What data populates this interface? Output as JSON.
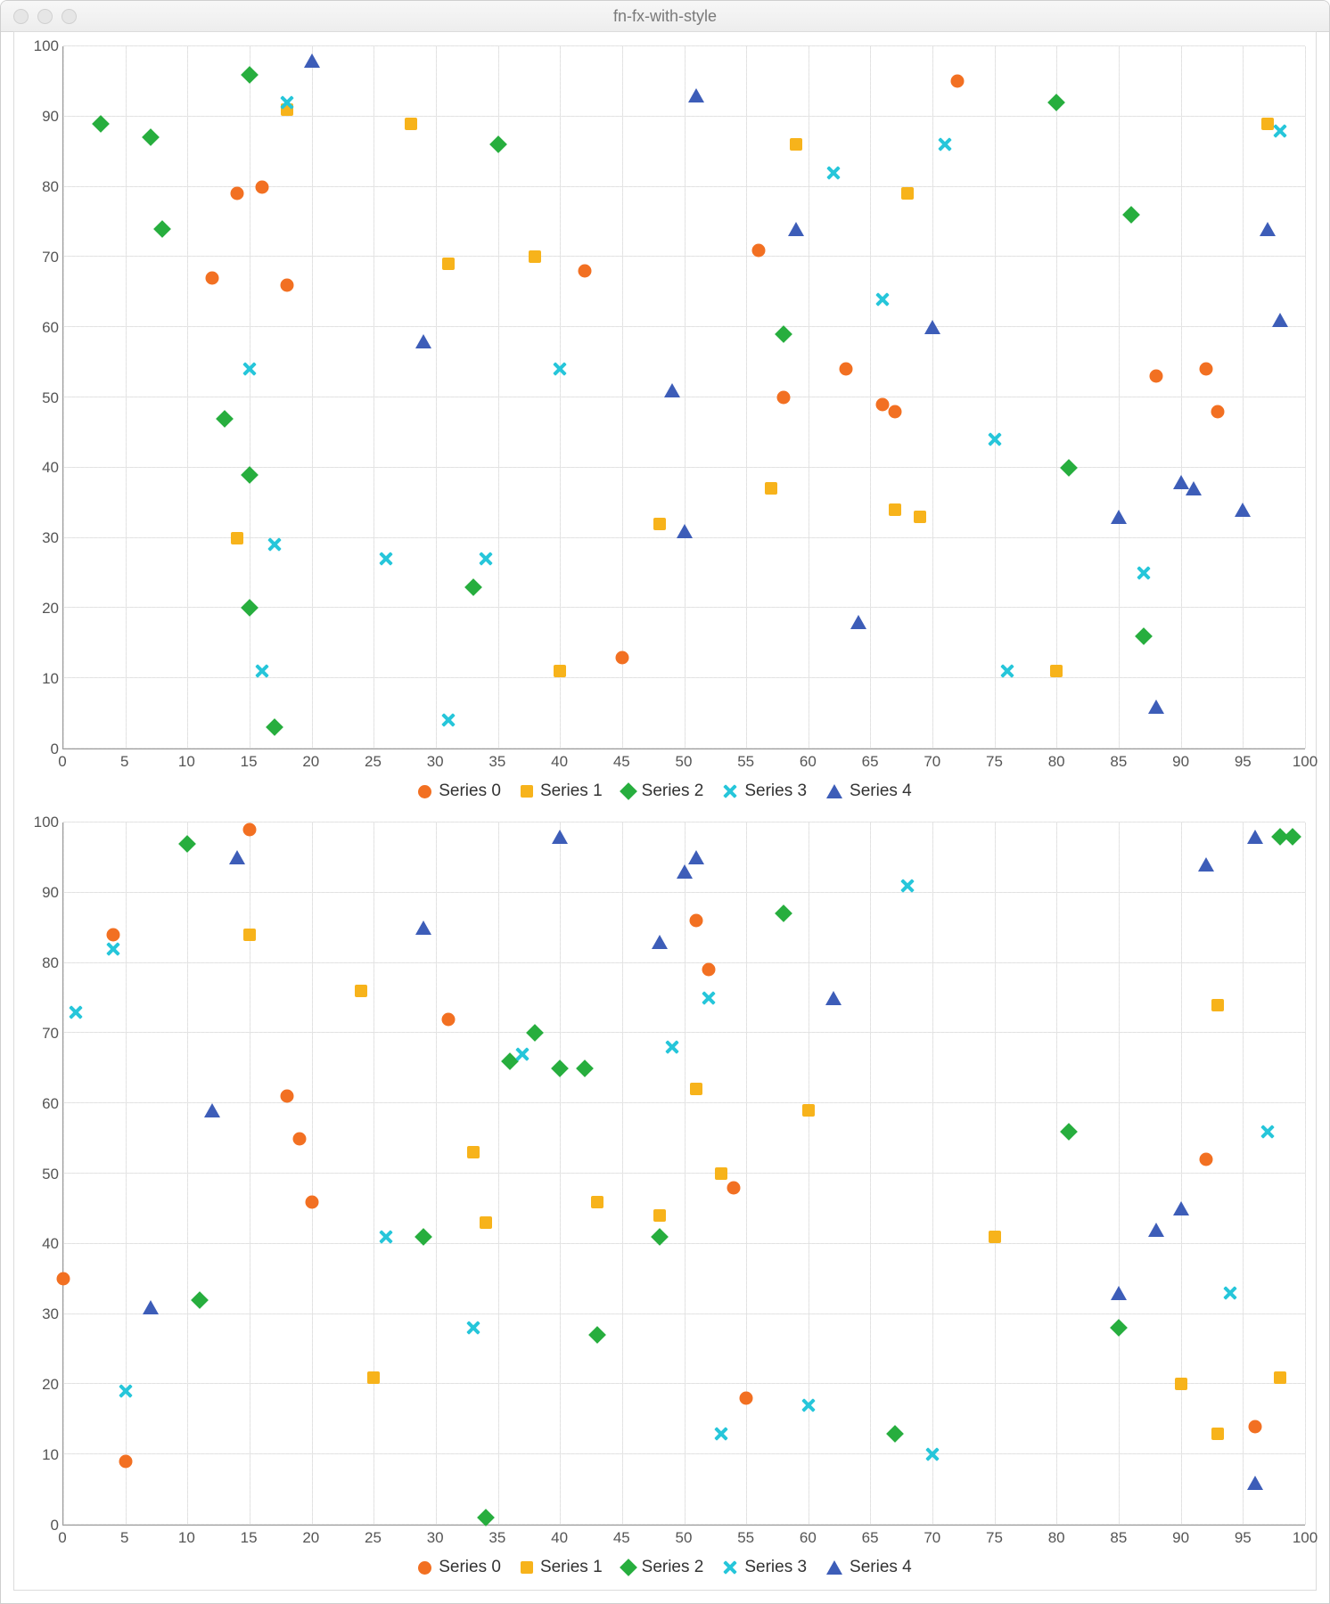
{
  "window": {
    "title": "fn-fx-with-style"
  },
  "colors": {
    "series0": "#f27022",
    "series1": "#f7b31b",
    "series2": "#27ae3e",
    "series3": "#26c6da",
    "series4": "#3d5db8"
  },
  "legend_labels": [
    "Series 0",
    "Series 1",
    "Series 2",
    "Series 3",
    "Series 4"
  ],
  "axis": {
    "xmin": 0,
    "xmax": 100,
    "ymin": 0,
    "ymax": 100,
    "xticks": [
      0,
      5,
      10,
      15,
      20,
      25,
      30,
      35,
      40,
      45,
      50,
      55,
      60,
      65,
      70,
      75,
      80,
      85,
      90,
      95,
      100
    ],
    "yticks": [
      0,
      10,
      20,
      30,
      40,
      50,
      60,
      70,
      80,
      90,
      100
    ]
  },
  "chart_data": [
    {
      "type": "scatter",
      "xlim": [
        0,
        100
      ],
      "ylim": [
        0,
        100
      ],
      "legend": [
        "Series 0",
        "Series 1",
        "Series 2",
        "Series 3",
        "Series 4"
      ],
      "series": [
        {
          "name": "Series 0",
          "marker": "circle",
          "color": "#f27022",
          "points": [
            [
              12,
              67
            ],
            [
              14,
              79
            ],
            [
              16,
              80
            ],
            [
              18,
              66
            ],
            [
              42,
              68
            ],
            [
              45,
              13
            ],
            [
              56,
              71
            ],
            [
              58,
              50
            ],
            [
              63,
              54
            ],
            [
              66,
              49
            ],
            [
              67,
              48
            ],
            [
              72,
              95
            ],
            [
              88,
              53
            ],
            [
              92,
              54
            ],
            [
              93,
              48
            ]
          ]
        },
        {
          "name": "Series 1",
          "marker": "square",
          "color": "#f7b31b",
          "points": [
            [
              14,
              30
            ],
            [
              18,
              91
            ],
            [
              28,
              89
            ],
            [
              31,
              69
            ],
            [
              38,
              70
            ],
            [
              40,
              11
            ],
            [
              48,
              32
            ],
            [
              57,
              37
            ],
            [
              59,
              86
            ],
            [
              67,
              34
            ],
            [
              68,
              79
            ],
            [
              69,
              33
            ],
            [
              80,
              11
            ],
            [
              97,
              89
            ]
          ]
        },
        {
          "name": "Series 2",
          "marker": "diamond",
          "color": "#27ae3e",
          "points": [
            [
              3,
              89
            ],
            [
              7,
              87
            ],
            [
              8,
              74
            ],
            [
              13,
              47
            ],
            [
              15,
              20
            ],
            [
              15,
              39
            ],
            [
              15,
              96
            ],
            [
              17,
              3
            ],
            [
              33,
              23
            ],
            [
              35,
              86
            ],
            [
              58,
              59
            ],
            [
              80,
              92
            ],
            [
              81,
              40
            ],
            [
              86,
              76
            ],
            [
              87,
              16
            ]
          ]
        },
        {
          "name": "Series 3",
          "marker": "cross",
          "color": "#26c6da",
          "points": [
            [
              15,
              54
            ],
            [
              16,
              11
            ],
            [
              17,
              29
            ],
            [
              18,
              92
            ],
            [
              26,
              27
            ],
            [
              31,
              4
            ],
            [
              34,
              27
            ],
            [
              40,
              54
            ],
            [
              62,
              82
            ],
            [
              66,
              64
            ],
            [
              71,
              86
            ],
            [
              75,
              44
            ],
            [
              76,
              11
            ],
            [
              87,
              25
            ],
            [
              98,
              88
            ]
          ]
        },
        {
          "name": "Series 4",
          "marker": "triangle",
          "color": "#3d5db8",
          "points": [
            [
              20,
              98
            ],
            [
              29,
              58
            ],
            [
              49,
              51
            ],
            [
              50,
              31
            ],
            [
              51,
              93
            ],
            [
              59,
              74
            ],
            [
              64,
              18
            ],
            [
              70,
              60
            ],
            [
              85,
              33
            ],
            [
              88,
              6
            ],
            [
              90,
              38
            ],
            [
              91,
              37
            ],
            [
              95,
              34
            ],
            [
              97,
              74
            ],
            [
              98,
              61
            ]
          ]
        }
      ]
    },
    {
      "type": "scatter",
      "xlim": [
        0,
        100
      ],
      "ylim": [
        0,
        100
      ],
      "legend": [
        "Series 0",
        "Series 1",
        "Series 2",
        "Series 3",
        "Series 4"
      ],
      "series": [
        {
          "name": "Series 0",
          "marker": "circle",
          "color": "#f27022",
          "points": [
            [
              0,
              35
            ],
            [
              4,
              84
            ],
            [
              5,
              9
            ],
            [
              15,
              99
            ],
            [
              18,
              61
            ],
            [
              19,
              55
            ],
            [
              20,
              46
            ],
            [
              31,
              72
            ],
            [
              51,
              86
            ],
            [
              52,
              79
            ],
            [
              54,
              48
            ],
            [
              55,
              18
            ],
            [
              92,
              52
            ],
            [
              96,
              14
            ]
          ]
        },
        {
          "name": "Series 1",
          "marker": "square",
          "color": "#f7b31b",
          "points": [
            [
              15,
              84
            ],
            [
              24,
              76
            ],
            [
              25,
              21
            ],
            [
              33,
              53
            ],
            [
              34,
              43
            ],
            [
              43,
              46
            ],
            [
              48,
              44
            ],
            [
              51,
              62
            ],
            [
              53,
              50
            ],
            [
              60,
              59
            ],
            [
              75,
              41
            ],
            [
              90,
              20
            ],
            [
              93,
              13
            ],
            [
              93,
              74
            ],
            [
              98,
              21
            ]
          ]
        },
        {
          "name": "Series 2",
          "marker": "diamond",
          "color": "#27ae3e",
          "points": [
            [
              10,
              97
            ],
            [
              11,
              32
            ],
            [
              29,
              41
            ],
            [
              34,
              1
            ],
            [
              36,
              66
            ],
            [
              38,
              70
            ],
            [
              40,
              65
            ],
            [
              42,
              65
            ],
            [
              43,
              27
            ],
            [
              48,
              41
            ],
            [
              58,
              87
            ],
            [
              67,
              13
            ],
            [
              81,
              56
            ],
            [
              85,
              28
            ],
            [
              98,
              98
            ],
            [
              99,
              98
            ]
          ]
        },
        {
          "name": "Series 3",
          "marker": "cross",
          "color": "#26c6da",
          "points": [
            [
              1,
              73
            ],
            [
              4,
              82
            ],
            [
              5,
              19
            ],
            [
              26,
              41
            ],
            [
              33,
              28
            ],
            [
              37,
              67
            ],
            [
              49,
              68
            ],
            [
              52,
              75
            ],
            [
              53,
              13
            ],
            [
              60,
              17
            ],
            [
              68,
              91
            ],
            [
              70,
              10
            ],
            [
              94,
              33
            ],
            [
              97,
              56
            ]
          ]
        },
        {
          "name": "Series 4",
          "marker": "triangle",
          "color": "#3d5db8",
          "points": [
            [
              7,
              31
            ],
            [
              12,
              59
            ],
            [
              14,
              95
            ],
            [
              29,
              85
            ],
            [
              40,
              98
            ],
            [
              48,
              83
            ],
            [
              50,
              93
            ],
            [
              51,
              95
            ],
            [
              62,
              75
            ],
            [
              85,
              33
            ],
            [
              88,
              42
            ],
            [
              90,
              45
            ],
            [
              92,
              94
            ],
            [
              96,
              6
            ],
            [
              96,
              98
            ]
          ]
        }
      ]
    }
  ]
}
